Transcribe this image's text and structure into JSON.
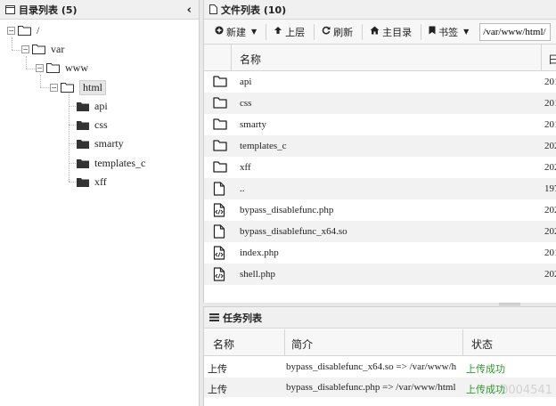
{
  "dir_panel": {
    "title": "目录列表 (5)",
    "collapse_glyph": "‹",
    "tree": [
      {
        "label": "/",
        "toggle": "−",
        "icon": "folder-open-icon",
        "selected": false
      },
      {
        "label": "var",
        "toggle": "−",
        "icon": "folder-open-icon",
        "selected": false
      },
      {
        "label": "www",
        "toggle": "−",
        "icon": "folder-open-icon",
        "selected": false
      },
      {
        "label": "html",
        "toggle": "−",
        "icon": "folder-open-icon",
        "selected": true
      },
      {
        "label": "api",
        "toggle": "",
        "icon": "folder-closed-icon",
        "selected": false
      },
      {
        "label": "css",
        "toggle": "",
        "icon": "folder-closed-icon",
        "selected": false
      },
      {
        "label": "smarty",
        "toggle": "",
        "icon": "folder-closed-icon",
        "selected": false
      },
      {
        "label": "templates_c",
        "toggle": "",
        "icon": "folder-closed-icon",
        "selected": false
      },
      {
        "label": "xff",
        "toggle": "",
        "icon": "folder-closed-icon",
        "selected": false
      }
    ]
  },
  "file_panel": {
    "title": "文件列表 (10)",
    "toolbar": {
      "new_label": "新建",
      "up_label": "上层",
      "refresh_label": "刷新",
      "home_label": "主目录",
      "bookmark_label": "书签",
      "path_value": "/var/www/html/"
    },
    "columns": {
      "name": "名称",
      "date": "日"
    },
    "files": [
      {
        "name": "api",
        "date": "201",
        "icon": "folder-outline-icon"
      },
      {
        "name": "css",
        "date": "201",
        "icon": "folder-outline-icon"
      },
      {
        "name": "smarty",
        "date": "201",
        "icon": "folder-outline-icon"
      },
      {
        "name": "templates_c",
        "date": "202",
        "icon": "folder-outline-icon"
      },
      {
        "name": "xff",
        "date": "202",
        "icon": "folder-outline-icon"
      },
      {
        "name": "..",
        "date": "197",
        "icon": "file-blank-icon"
      },
      {
        "name": "bypass_disablefunc.php",
        "date": "202",
        "icon": "file-code-icon"
      },
      {
        "name": "bypass_disablefunc_x64.so",
        "date": "202",
        "icon": "file-blank-icon"
      },
      {
        "name": "index.php",
        "date": "201",
        "icon": "file-code-icon"
      },
      {
        "name": "shell.php",
        "date": "202",
        "icon": "file-code-icon"
      }
    ]
  },
  "task_panel": {
    "title": "任务列表",
    "columns": {
      "name": "名称",
      "desc": "简介",
      "status": "状态"
    },
    "rows": [
      {
        "name": "上传",
        "desc": "bypass_disablefunc_x64.so => /var/www/h",
        "status": "上传成功"
      },
      {
        "name": "上传",
        "desc": "bypass_disablefunc.php => /var/www/html",
        "status": "上传成功"
      }
    ]
  },
  "watermark": "0004541",
  "colors": {
    "success": "#2a9a2a",
    "header_bg": "#f0f0f0",
    "alt_row": "#f2f2f2"
  }
}
